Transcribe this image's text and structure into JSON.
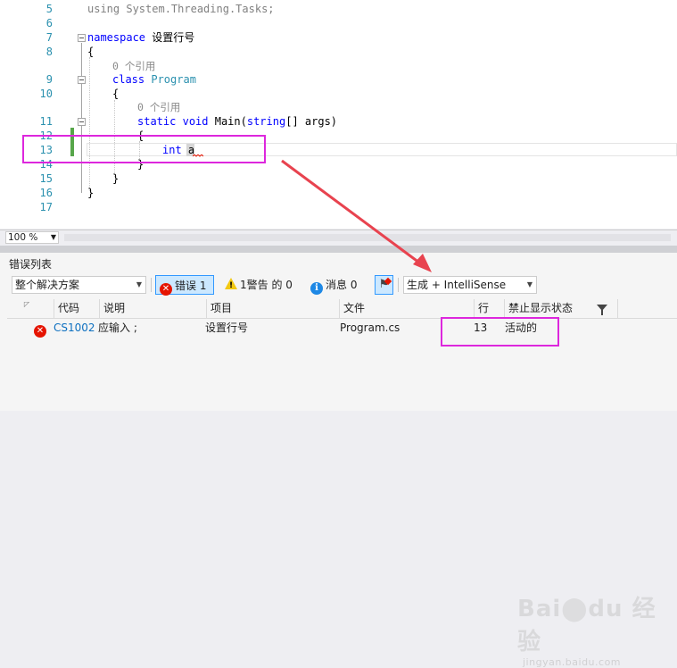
{
  "editor": {
    "lines": {
      "l5": {
        "num": "5",
        "text": "using System.Threading.Tasks;"
      },
      "l6": {
        "num": "6"
      },
      "l7": {
        "num": "7",
        "kw": "namespace",
        "name": "设置行号"
      },
      "l8": {
        "num": "8",
        "text": "{"
      },
      "ref1": {
        "text": "0 个引用"
      },
      "l9": {
        "num": "9",
        "kw": "class",
        "name": "Program"
      },
      "l10": {
        "num": "10",
        "text": "{"
      },
      "ref2": {
        "text": "0 个引用"
      },
      "l11": {
        "num": "11",
        "kw1": "static",
        "kw2": "void",
        "rest1": "Main(",
        "kw3": "string",
        "rest2": "[] args)"
      },
      "l12": {
        "num": "12",
        "text": "{"
      },
      "l13": {
        "num": "13",
        "kw": "int",
        "name": "a"
      },
      "l14": {
        "num": "14",
        "text": "}"
      },
      "l15": {
        "num": "15",
        "text": "}"
      },
      "l16": {
        "num": "16",
        "text": "}"
      },
      "l17": {
        "num": "17"
      }
    }
  },
  "zoom": {
    "value": "100 %"
  },
  "error_list": {
    "title": "错误列表",
    "scope": "整个解决方案",
    "errors_btn": "错误 1",
    "warnings_btn": "1警告 的 0",
    "messages_btn": "消息 0",
    "source": "生成 + IntelliSense",
    "columns": {
      "code": "代码",
      "desc": "说明",
      "project": "项目",
      "file": "文件",
      "line": "行",
      "suppress": "禁止显示状态"
    },
    "row": {
      "code": "CS1002",
      "desc": "应输入 ;",
      "project": "设置行号",
      "file": "Program.cs",
      "line": "13",
      "suppress": "活动的"
    }
  },
  "colors": {
    "annotation": "#dd27dd",
    "arrow": "#e8434f",
    "error": "#e51400",
    "link": "#0e70c0",
    "linenum": "#2b91af"
  },
  "icons": [
    "error-icon",
    "warning-icon",
    "info-icon",
    "filter-icon",
    "funnel-icon",
    "collapse-icon"
  ],
  "watermark": {
    "logo": "Baidu经验",
    "url": "jingyan.baidu.com"
  }
}
